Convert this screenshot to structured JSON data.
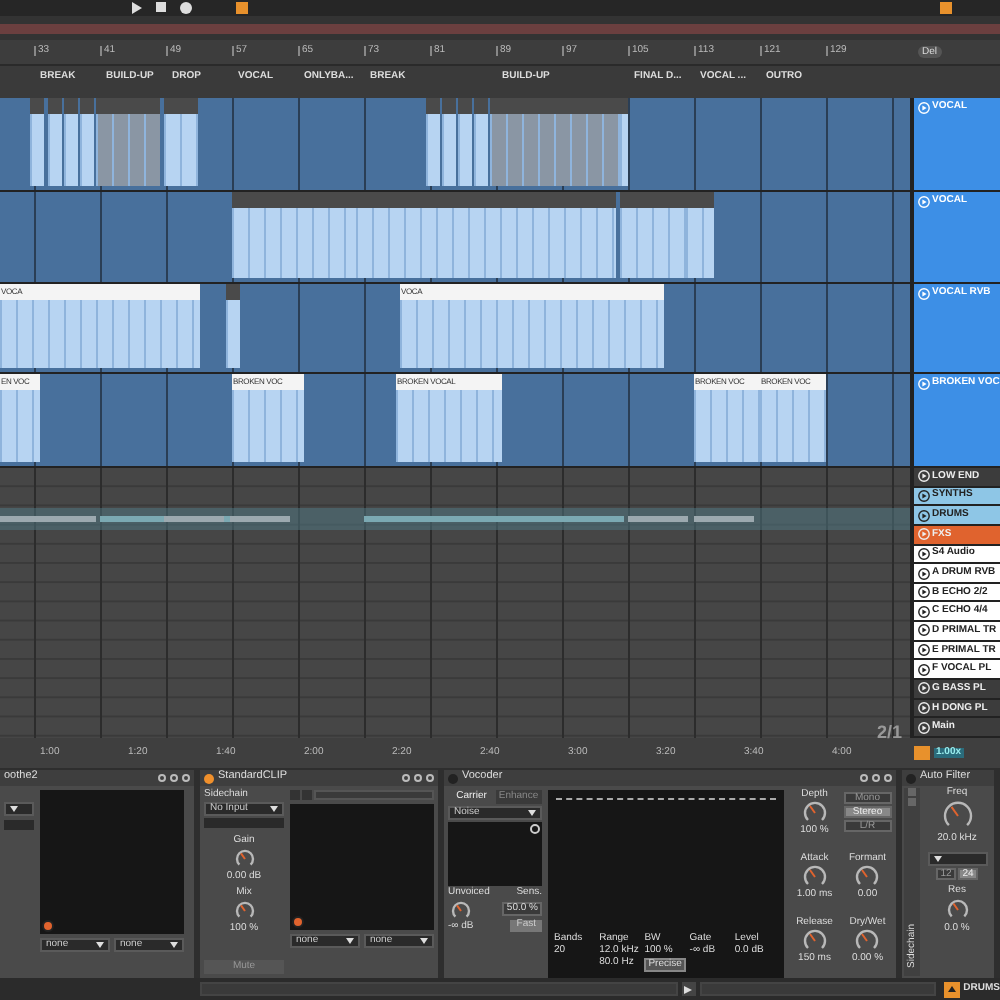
{
  "ruler": {
    "bars": [
      "33",
      "41",
      "49",
      "57",
      "65",
      "73",
      "81",
      "89",
      "97",
      "105",
      "113",
      "121",
      "129"
    ],
    "delete_button": "Del"
  },
  "locators": [
    {
      "label": "BREAK"
    },
    {
      "label": "BUILD-UP"
    },
    {
      "label": "DROP"
    },
    {
      "label": "VOCAL"
    },
    {
      "label": "ONLYBA..."
    },
    {
      "label": "BREAK"
    },
    {
      "label": "BUILD-UP"
    },
    {
      "label": "FINAL D..."
    },
    {
      "label": "VOCAL ..."
    },
    {
      "label": "OUTRO"
    }
  ],
  "tracks": [
    {
      "name": "VOCAL"
    },
    {
      "name": "VOCAL"
    },
    {
      "name": "VOCAL RVB",
      "clips": [
        {
          "label": "VOCA"
        },
        {
          "label": "VOCA"
        }
      ]
    },
    {
      "name": "BROKEN VOC",
      "clips": [
        {
          "label": "EN VOC"
        },
        {
          "label": "BROKEN VOC"
        },
        {
          "label": "BROKEN VOCAL"
        },
        {
          "label": "BROKEN VOC"
        },
        {
          "label": "BROKEN VOC"
        }
      ]
    }
  ],
  "groups": [
    {
      "name": "LOW END",
      "color": "#3c3c3c"
    },
    {
      "name": "SYNTHS",
      "color": "#8ec6e6"
    },
    {
      "name": "DRUMS",
      "color": "#8ec6e6"
    },
    {
      "name": "FXS",
      "color": "#e0632e"
    },
    {
      "name": "S4 Audio",
      "color": "#ffffff"
    },
    {
      "name": "A DRUM RVB",
      "color": "#ffffff"
    },
    {
      "name": "B ECHO 2/2",
      "color": "#ffffff"
    },
    {
      "name": "C ECHO 4/4",
      "color": "#ffffff"
    },
    {
      "name": "D PRIMAL TR",
      "color": "#ffffff"
    },
    {
      "name": "E PRIMAL TR",
      "color": "#ffffff"
    },
    {
      "name": "F VOCAL PL",
      "color": "#ffffff"
    },
    {
      "name": "G BASS PL",
      "color": "#3c3c3c"
    },
    {
      "name": "H DONG PL",
      "color": "#3c3c3c"
    },
    {
      "name": "Main",
      "color": "#3c3c3c"
    }
  ],
  "time_ruler": {
    "times": [
      "1:00",
      "1:20",
      "1:40",
      "2:00",
      "2:20",
      "2:40",
      "3:00",
      "3:20",
      "3:40",
      "4:00"
    ],
    "zoom_ratio": "2/1",
    "tempo_scale": "1.00x"
  },
  "soothe": {
    "title": "oothe2",
    "outputs": [
      "none",
      "none"
    ]
  },
  "clipper": {
    "title": "StandardCLIP",
    "sidechain_label": "Sidechain",
    "sidechain_input": "No Input",
    "gain_label": "Gain",
    "gain_value": "0.00 dB",
    "mix_label": "Mix",
    "mix_value": "100 %",
    "mute_button": "Mute",
    "outputs": [
      "none",
      "none"
    ]
  },
  "vocoder": {
    "title": "Vocoder",
    "tabs": [
      {
        "label": "Carrier",
        "selected": true
      },
      {
        "label": "Enhance",
        "selected": false
      }
    ],
    "carrier": "Noise",
    "unvoiced_label": "Unvoiced",
    "unvoiced_value": "-∞ dB",
    "sens_label": "Sens.",
    "sens_value": "50.0 %",
    "fast_button": "Fast",
    "params": [
      {
        "label": "Bands",
        "value": "20"
      },
      {
        "label": "Range",
        "value": "12.0 kHz",
        "value2": "80.0 Hz"
      },
      {
        "label": "BW",
        "value": "100 %",
        "value2": "Precise"
      },
      {
        "label": "Gate",
        "value": "-∞ dB"
      },
      {
        "label": "Level",
        "value": "0.0 dB"
      }
    ],
    "depth_label": "Depth",
    "depth_value": "100 %",
    "modes": [
      {
        "label": "Mono",
        "selected": false
      },
      {
        "label": "Stereo",
        "selected": true
      },
      {
        "label": "L/R",
        "selected": false
      }
    ],
    "knobs": [
      {
        "label": "Attack",
        "value": "1.00 ms"
      },
      {
        "label": "Formant",
        "value": "0.00"
      },
      {
        "label": "Release",
        "value": "150 ms"
      },
      {
        "label": "Dry/Wet",
        "value": "0.00 %"
      }
    ]
  },
  "auto_filter": {
    "title": "Auto Filter",
    "sidechain_label": "Sidechain",
    "freq_label": "Freq",
    "freq_value": "20.0 kHz",
    "slopes": [
      {
        "label": "12",
        "selected": false
      },
      {
        "label": "24",
        "selected": true
      }
    ],
    "res_label": "Res",
    "res_value": "0.0 %"
  },
  "status_bar": {
    "track": "DRUMS"
  }
}
